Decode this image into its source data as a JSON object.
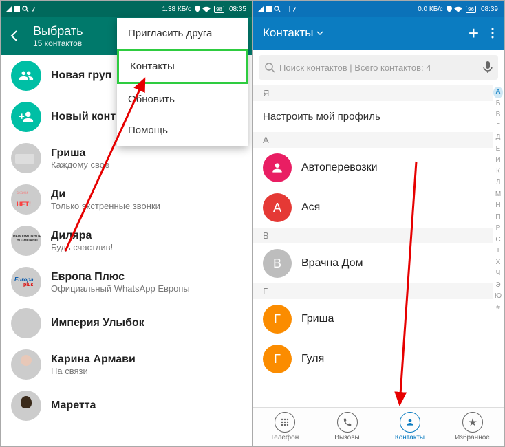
{
  "left": {
    "statusbar": {
      "data": "1.38 КБ/с",
      "battery": "98",
      "time": "08:35"
    },
    "header": {
      "title": "Выбрать",
      "subtitle": "15 контактов"
    },
    "menu": [
      "Пригласить друга",
      "Контакты",
      "Обновить",
      "Помощь"
    ],
    "rows": [
      {
        "name": "Новая груп",
        "status": ""
      },
      {
        "name": "Новый конт",
        "status": ""
      },
      {
        "name": "Гриша",
        "status": "Каждому свое"
      },
      {
        "name": "Ди",
        "status": "Только экстренные звонки"
      },
      {
        "name": "Диляра",
        "status": "Будь счастлив!"
      },
      {
        "name": "Европа Плюс",
        "status": "Официальный WhatsApp Европы"
      },
      {
        "name": "Империя Улыбок",
        "status": ""
      },
      {
        "name": "Карина Армави",
        "status": "На связи"
      },
      {
        "name": "Маретта",
        "status": ""
      }
    ]
  },
  "right": {
    "statusbar": {
      "data": "0.0 КБ/с",
      "battery": "96",
      "time": "08:39"
    },
    "header": {
      "title": "Контакты"
    },
    "search_placeholder": "Поиск контактов | Всего контактов: 4",
    "sections": {
      "me_label": "Я",
      "profile": "Настроить мой профиль",
      "groups": [
        {
          "letter": "А",
          "items": [
            {
              "initial": "",
              "name": "Автоперевозки",
              "color": "c-pink",
              "icon": "person"
            },
            {
              "initial": "А",
              "name": "Ася",
              "color": "c-red"
            }
          ]
        },
        {
          "letter": "В",
          "items": [
            {
              "initial": "В",
              "name": "Врачна Дом",
              "color": "c-grey"
            }
          ]
        },
        {
          "letter": "Г",
          "items": [
            {
              "initial": "Г",
              "name": "Гриша",
              "color": "c-orange"
            },
            {
              "initial": "Г",
              "name": "Гуля",
              "color": "c-orange"
            }
          ]
        }
      ]
    },
    "index": [
      "А",
      "Б",
      "В",
      "Г",
      "Д",
      "Е",
      "И",
      "К",
      "Л",
      "М",
      "Н",
      "П",
      "Р",
      "С",
      "Т",
      "Х",
      "Ч",
      "Э",
      "Ю",
      "#"
    ],
    "nav": [
      {
        "label": "Телефон",
        "icon": "dialpad"
      },
      {
        "label": "Вызовы",
        "icon": "phone"
      },
      {
        "label": "Контакты",
        "icon": "person",
        "active": true
      },
      {
        "label": "Избранное",
        "icon": "star"
      }
    ]
  }
}
